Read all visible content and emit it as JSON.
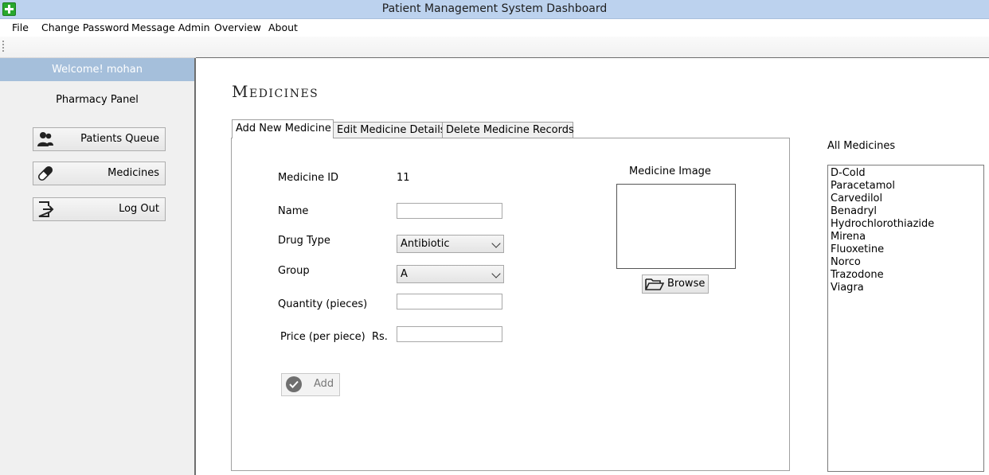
{
  "window": {
    "title": "Patient Management System Dashboard"
  },
  "menu": [
    "File",
    "Change Password",
    "Message Admin",
    "Overview",
    "About"
  ],
  "sidebar": {
    "welcome": "Welcome! mohan",
    "panel_title": "Pharmacy Panel",
    "buttons": [
      {
        "label": "Patients Queue",
        "icon": "users-icon"
      },
      {
        "label": "Medicines",
        "icon": "pill-icon"
      },
      {
        "label": "Log Out",
        "icon": "logout-icon"
      }
    ]
  },
  "main": {
    "heading": "Medicines",
    "tabs": [
      "Add New Medicine",
      "Edit Medicine Details",
      "Delete Medicine Records"
    ],
    "active_tab": 0,
    "form": {
      "medicine_id_label": "Medicine ID",
      "medicine_id_value": "11",
      "name_label": "Name",
      "name_value": "",
      "drug_type_label": "Drug Type",
      "drug_type_value": "Antibiotic",
      "group_label": "Group",
      "group_value": "A",
      "quantity_label": "Quantity (pieces)",
      "quantity_value": "",
      "price_label": "Price (per piece)",
      "price_unit": "Rs.",
      "price_value": "",
      "add_label": "Add",
      "image_label": "Medicine Image",
      "browse_label": "Browse"
    }
  },
  "list": {
    "title": "All Medicines",
    "items": [
      "D-Cold",
      "Paracetamol",
      "Carvedilol",
      "Benadryl",
      "Hydrochlorothiazide",
      "Mirena",
      "Fluoxetine",
      "Norco",
      "Trazodone",
      "Viagra"
    ]
  }
}
